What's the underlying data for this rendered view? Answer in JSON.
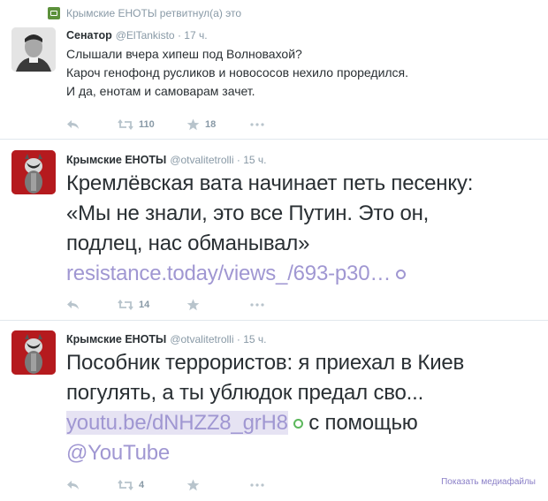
{
  "tweets": [
    {
      "retweet_note": "Крымские ЕНОТЫ ретвитнул(а) это",
      "name": "Сенатор",
      "handle": "@ElTankisto",
      "time": "· 17 ч.",
      "lines": [
        "Слышали вчера хипеш под Волновахой?",
        "Кароч генофонд русликов и новососов нехило проредился.",
        "И да, енотам и самоварам зачет."
      ],
      "retweets": "110",
      "favorites": "18"
    },
    {
      "name": "Крымские ЕНОТЫ",
      "handle": "@otvalitetrolli",
      "time": "· 15 ч.",
      "lines": [
        "Кремлёвская вата начинает петь песенку:",
        "«Мы не знали, это все Путин. Это он,",
        "подлец, нас обманывал»"
      ],
      "link": "resistance.today/views_/693-p30…",
      "retweets": "14",
      "favorites": ""
    },
    {
      "name": "Крымские ЕНОТЫ",
      "handle": "@otvalitetrolli",
      "time": "· 15 ч.",
      "lines": [
        "Пособник террористов: я приехал в Киев",
        "погулять, а ты ублюдок предал сво..."
      ],
      "link": "youtu.be/dNHZZ8_grH8",
      "after_link": "с помощью",
      "mention": "@YouTube",
      "retweets": "4",
      "favorites": "",
      "media_label": "Показать медиафайлы"
    }
  ]
}
